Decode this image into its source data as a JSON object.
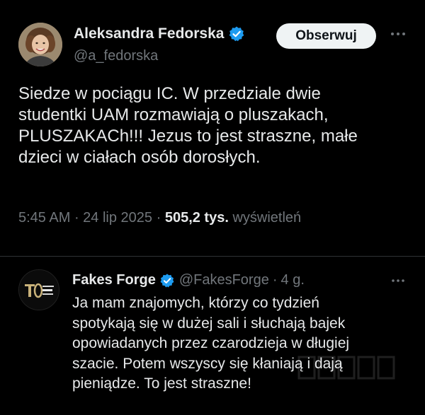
{
  "tweet": {
    "author": {
      "display_name": "Aleksandra Fedorska",
      "handle": "@a_fedorska",
      "verified": true
    },
    "follow_label": "Obserwuj",
    "text_lines": [
      "Siedze w pociągu IC. W przedziale dwie",
      "studentki UAM rozmawiają o pluszakach,",
      "PLUSZAKACh!!! Jezus to jest straszne, małe",
      "dzieci w ciałach osób dorosłych."
    ],
    "meta": {
      "time": "5:45 AM",
      "date": "24 lip 2025",
      "views_count": "505,2 tys.",
      "views_label": "wyświetleń"
    }
  },
  "reply": {
    "author": {
      "display_name": "Fakes Forge",
      "handle": "@FakesForge",
      "verified": true
    },
    "time_ago": "4 g.",
    "text_lines": [
      "Ja mam znajomych, którzy co tydzień",
      "spotykają się w dużej sali i słuchają bajek",
      "opowiadanych przez czarodzieja w długiej",
      "szacie. Potem wszyscy się kłaniają i dają",
      "pieniądze. To jest straszne!"
    ]
  },
  "colors": {
    "background": "#000000",
    "text_primary": "#e7e9ea",
    "text_secondary": "#71767b",
    "verified_blue": "#1d9bf0",
    "divider": "#2f3336",
    "follow_bg": "#eff3f4"
  },
  "icons": {
    "verified": "verified-badge-icon",
    "more": "more-horizontal-icon"
  }
}
